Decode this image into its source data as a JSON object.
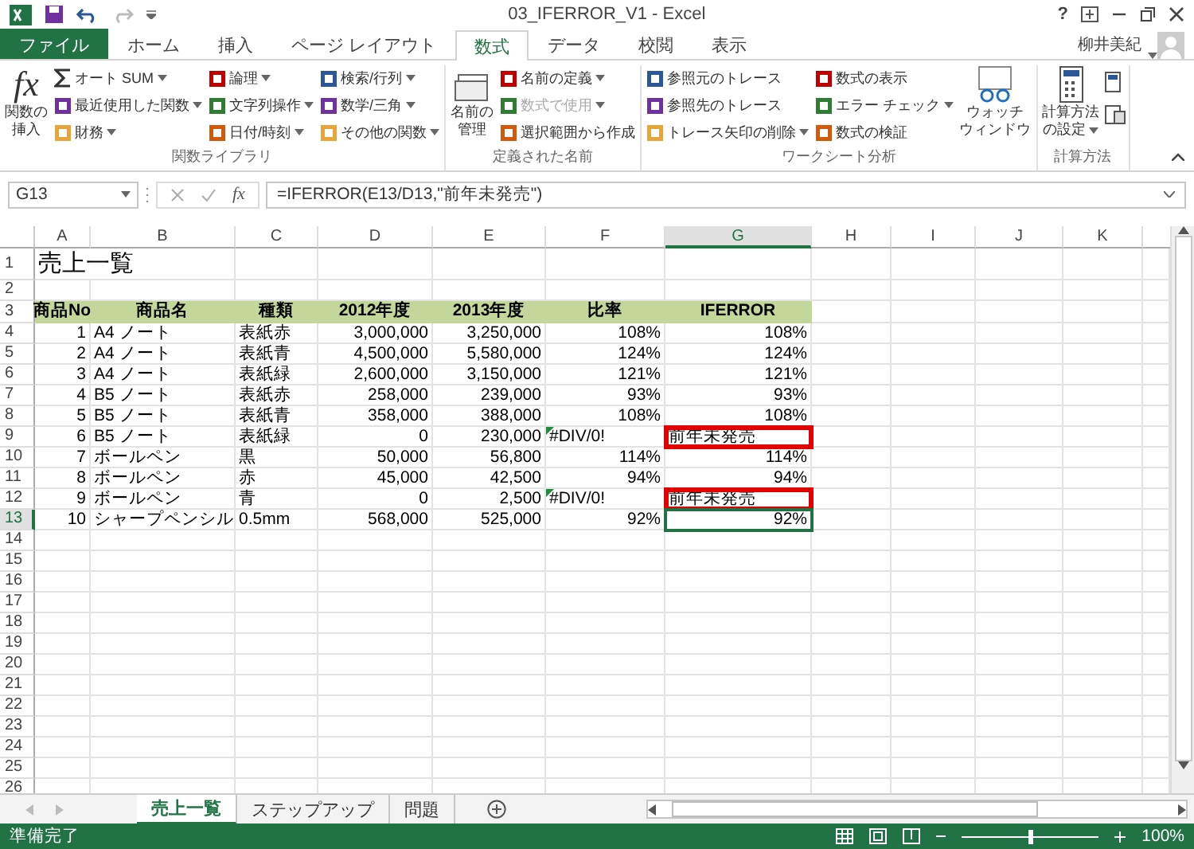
{
  "title_bar": {
    "title": "03_IFERROR_V1 - Excel",
    "help": "?"
  },
  "tabs": [
    {
      "label": "ファイル",
      "kind": "file",
      "selected": false
    },
    {
      "label": "ホーム",
      "kind": "tab",
      "selected": false
    },
    {
      "label": "挿入",
      "kind": "tab",
      "selected": false
    },
    {
      "label": "ページ レイアウト",
      "kind": "tab",
      "selected": false
    },
    {
      "label": "数式",
      "kind": "tab",
      "selected": true
    },
    {
      "label": "データ",
      "kind": "tab",
      "selected": false
    },
    {
      "label": "校閲",
      "kind": "tab",
      "selected": false
    },
    {
      "label": "表示",
      "kind": "tab",
      "selected": false
    }
  ],
  "user": {
    "name": "柳井美紀"
  },
  "ribbon": [
    {
      "label": "関数ライブラリ",
      "large": [
        {
          "fx": "fx",
          "lines": [
            "関数の",
            "挿入"
          ],
          "dropdown": false
        }
      ],
      "columns": [
        [
          {
            "label": "オート SUM",
            "dropdown": true,
            "disabled": false
          },
          {
            "label": "最近使用した関数",
            "dropdown": true,
            "disabled": false
          },
          {
            "label": "財務",
            "dropdown": true,
            "disabled": false
          }
        ],
        [
          {
            "label": "論理",
            "dropdown": true,
            "disabled": false
          },
          {
            "label": "文字列操作",
            "dropdown": true,
            "disabled": false
          },
          {
            "label": "日付/時刻",
            "dropdown": true,
            "disabled": false
          }
        ],
        [
          {
            "label": "検索/行列",
            "dropdown": true,
            "disabled": false
          },
          {
            "label": "数学/三角",
            "dropdown": true,
            "disabled": false
          },
          {
            "label": "その他の関数",
            "dropdown": true,
            "disabled": false
          }
        ]
      ]
    },
    {
      "label": "定義された名前",
      "large": [
        {
          "lines": [
            "名前の",
            "管理"
          ],
          "dropdown": false
        }
      ],
      "columns": [
        [
          {
            "label": "名前の定義",
            "dropdown": true,
            "disabled": false
          },
          {
            "label": "数式で使用",
            "dropdown": true,
            "disabled": true
          },
          {
            "label": "選択範囲から作成",
            "dropdown": false,
            "disabled": false
          }
        ]
      ]
    },
    {
      "label": "ワークシート分析",
      "columns": [
        [
          {
            "label": "参照元のトレース",
            "dropdown": false,
            "disabled": false
          },
          {
            "label": "参照先のトレース",
            "dropdown": false,
            "disabled": false
          },
          {
            "label": "トレース矢印の削除",
            "dropdown": true,
            "disabled": false
          }
        ],
        [
          {
            "label": "数式の表示",
            "dropdown": false,
            "disabled": false
          },
          {
            "label": "エラー チェック",
            "dropdown": true,
            "disabled": false
          },
          {
            "label": "数式の検証",
            "dropdown": false,
            "disabled": false
          }
        ]
      ],
      "after": [
        {
          "lines": [
            "ウォッチ",
            "ウィンドウ"
          ],
          "dropdown": false
        }
      ]
    },
    {
      "label": "計算方法",
      "large": [
        {
          "lines": [
            "計算方法",
            "の設定"
          ],
          "dropdown": true
        }
      ]
    }
  ],
  "formula_bar": {
    "name_box": "G13",
    "fx": "fx",
    "formula": "=IFERROR(E13/D13,\"前年未発売\")"
  },
  "columns": [
    {
      "label": "A",
      "selected": false
    },
    {
      "label": "B",
      "selected": false
    },
    {
      "label": "C",
      "selected": false
    },
    {
      "label": "D",
      "selected": false
    },
    {
      "label": "E",
      "selected": false
    },
    {
      "label": "F",
      "selected": false
    },
    {
      "label": "G",
      "selected": true
    },
    {
      "label": "H",
      "selected": false
    },
    {
      "label": "I",
      "selected": false
    },
    {
      "label": "J",
      "selected": false
    },
    {
      "label": "K",
      "selected": false
    }
  ],
  "rows": [
    {
      "number": "1",
      "kind": "title",
      "selected": false,
      "cells": [
        "売上一覧"
      ]
    },
    {
      "number": "2",
      "kind": "empty",
      "selected": false
    },
    {
      "number": "3",
      "kind": "header",
      "selected": false,
      "cells": [
        "商品No",
        "商品名",
        "種類",
        "2012年度",
        "2013年度",
        "比率",
        "IFERROR"
      ]
    },
    {
      "number": "4",
      "kind": "data",
      "selected": false,
      "error_mark": false,
      "highlight": false,
      "cells": [
        "1",
        "A4 ノート",
        "表紙赤",
        "3,000,000",
        "3,250,000",
        "108%",
        "108%"
      ]
    },
    {
      "number": "5",
      "kind": "data",
      "selected": false,
      "error_mark": false,
      "highlight": false,
      "cells": [
        "2",
        "A4 ノート",
        "表紙青",
        "4,500,000",
        "5,580,000",
        "124%",
        "124%"
      ]
    },
    {
      "number": "6",
      "kind": "data",
      "selected": false,
      "error_mark": false,
      "highlight": false,
      "cells": [
        "3",
        "A4 ノート",
        "表紙緑",
        "2,600,000",
        "3,150,000",
        "121%",
        "121%"
      ]
    },
    {
      "number": "7",
      "kind": "data",
      "selected": false,
      "error_mark": false,
      "highlight": false,
      "cells": [
        "4",
        "B5 ノート",
        "表紙赤",
        "258,000",
        "239,000",
        "93%",
        "93%"
      ]
    },
    {
      "number": "8",
      "kind": "data",
      "selected": false,
      "error_mark": false,
      "highlight": false,
      "cells": [
        "5",
        "B5 ノート",
        "表紙青",
        "358,000",
        "388,000",
        "108%",
        "108%"
      ]
    },
    {
      "number": "9",
      "kind": "data",
      "selected": false,
      "error_mark": true,
      "highlight": true,
      "cells": [
        "6",
        "B5 ノート",
        "表紙緑",
        "0",
        "230,000",
        "#DIV/0!",
        "前年未発売"
      ]
    },
    {
      "number": "10",
      "kind": "data",
      "selected": false,
      "error_mark": false,
      "highlight": false,
      "cells": [
        "7",
        "ボールペン",
        "黒",
        "50,000",
        "56,800",
        "114%",
        "114%"
      ]
    },
    {
      "number": "11",
      "kind": "data",
      "selected": false,
      "error_mark": false,
      "highlight": false,
      "cells": [
        "8",
        "ボールペン",
        "赤",
        "45,000",
        "42,500",
        "94%",
        "94%"
      ]
    },
    {
      "number": "12",
      "kind": "data",
      "selected": false,
      "error_mark": true,
      "highlight": true,
      "cells": [
        "9",
        "ボールペン",
        "青",
        "0",
        "2,500",
        "#DIV/0!",
        "前年未発売"
      ]
    },
    {
      "number": "13",
      "kind": "data",
      "selected": true,
      "error_mark": false,
      "highlight": false,
      "cells": [
        "10",
        "シャープペンシル",
        "0.5mm",
        "568,000",
        "525,000",
        "92%",
        "92%"
      ]
    },
    {
      "number": "14",
      "kind": "empty",
      "selected": false
    },
    {
      "number": "15",
      "kind": "empty",
      "selected": false
    },
    {
      "number": "16",
      "kind": "empty",
      "selected": false
    },
    {
      "number": "17",
      "kind": "empty",
      "selected": false
    },
    {
      "number": "18",
      "kind": "empty",
      "selected": false
    },
    {
      "number": "19",
      "kind": "empty",
      "selected": false
    },
    {
      "number": "20",
      "kind": "empty",
      "selected": false
    },
    {
      "number": "21",
      "kind": "empty",
      "selected": false
    },
    {
      "number": "22",
      "kind": "empty",
      "selected": false
    },
    {
      "number": "23",
      "kind": "empty",
      "selected": false
    },
    {
      "number": "24",
      "kind": "empty",
      "selected": false
    },
    {
      "number": "25",
      "kind": "empty",
      "selected": false
    },
    {
      "number": "26",
      "kind": "empty",
      "selected": false
    }
  ],
  "sheets": [
    {
      "label": "売上一覧",
      "selected": true
    },
    {
      "label": "ステップアップ",
      "selected": false
    },
    {
      "label": "問題",
      "selected": false
    }
  ],
  "status_bar": {
    "status": "準備完了",
    "zoom": "100%",
    "zoom_slider": {
      "level": 0.5
    }
  }
}
